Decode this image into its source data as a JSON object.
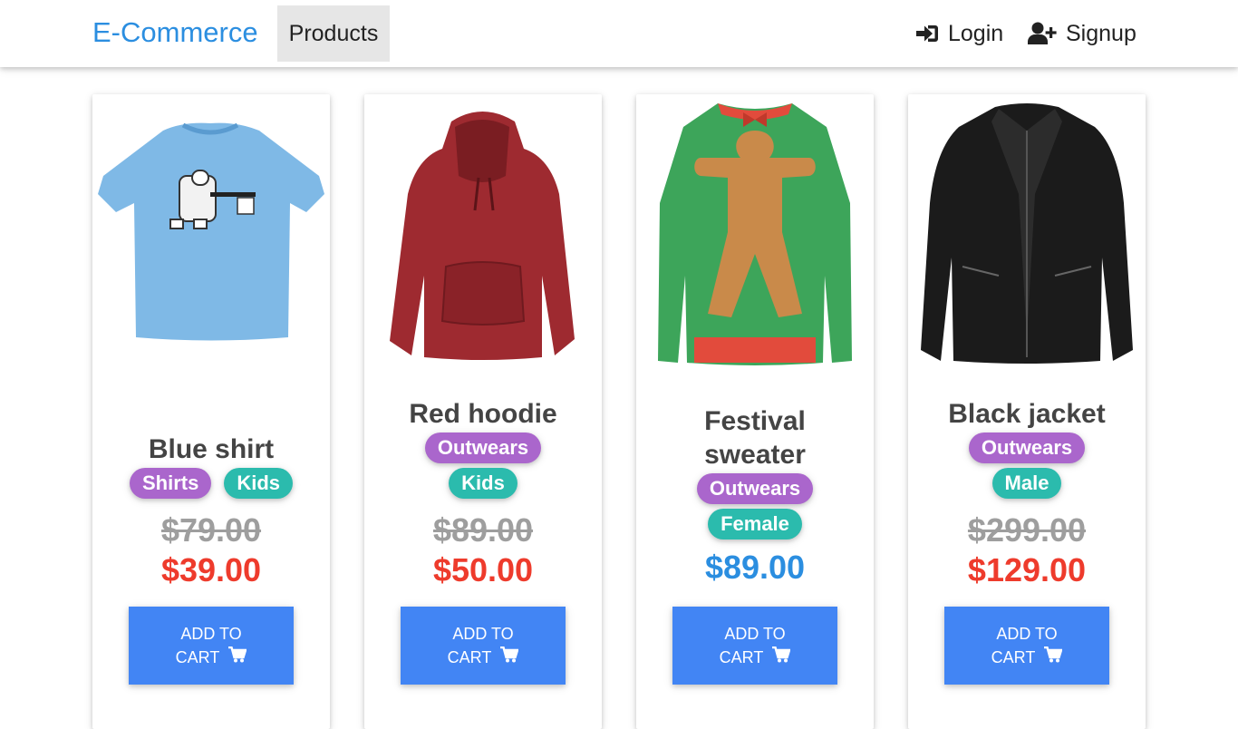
{
  "nav": {
    "brand": "E-Commerce",
    "products": "Products",
    "login": "Login",
    "signup": "Signup",
    "login_icon": "sign-in-icon",
    "signup_icon": "user-plus-icon"
  },
  "colors": {
    "brand": "#2b8ee0",
    "purple_badge": "#aa66cc",
    "teal_badge": "#2bbbad",
    "sale_price": "#ee3b2c",
    "regular_price": "#2b8ee0",
    "button": "#4285f4"
  },
  "button": {
    "line1": "ADD TO",
    "line2": "CART",
    "icon": "shopping-cart-icon"
  },
  "products": [
    {
      "name": "Blue shirt",
      "image": "blue-tshirt-image",
      "tags": [
        "Shirts",
        "Kids"
      ],
      "old_price": "$79.00",
      "price": "$39.00"
    },
    {
      "name": "Red hoodie",
      "image": "red-hoodie-image",
      "tags": [
        "Outwears",
        "Kids"
      ],
      "old_price": "$89.00",
      "price": "$50.00"
    },
    {
      "name": "Festival sweater",
      "image": "gingerbread-sweater-image",
      "tags": [
        "Outwears",
        "Female"
      ],
      "old_price": "",
      "price": "$89.00"
    },
    {
      "name": "Black jacket",
      "image": "black-leather-jacket-image",
      "tags": [
        "Outwears",
        "Male"
      ],
      "old_price": "$299.00",
      "price": "$129.00"
    }
  ]
}
